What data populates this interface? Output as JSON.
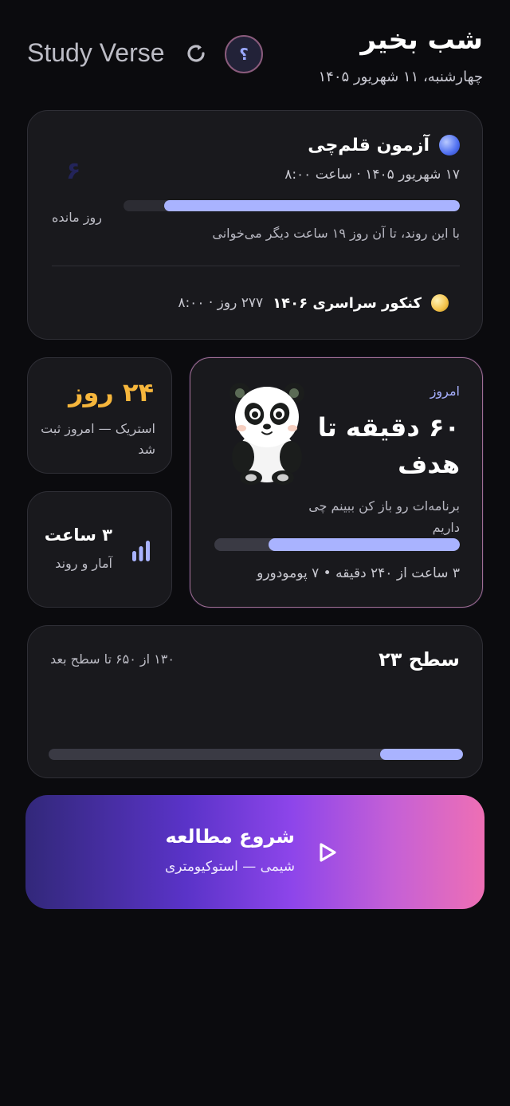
{
  "header": {
    "greeting": "شب بخیر",
    "date": "چهارشنبه، ۱۱ شهریور ۱۴۰۵",
    "brand": "Study Verse",
    "help_glyph": "؟"
  },
  "exam": {
    "title": "آزمون قلم‌چی",
    "date": "۱۷ شهریور ۱۴۰۵ · ساعت ۸:۰۰",
    "countdown_value": "۶",
    "countdown_label": "روز مانده",
    "progress_fraction": 0.88,
    "hint": "با این روند، تا آن روز ۱۹ ساعت دیگر می‌خوانی",
    "next_title": "کنکور سراسری ۱۴۰۶",
    "next_meta": "۲۷۷ روز · ۸:۰۰"
  },
  "streak": {
    "value": "۲۴ روز",
    "subtitle": "استریک — امروز ثبت شد"
  },
  "stats": {
    "value": "۳ ساعت",
    "subtitle": "آمار و روند",
    "icon": "bar-chart-icon"
  },
  "today": {
    "label": "امروز",
    "goal": "۶۰ دقیقه تا هدف",
    "message": "برنامه‌ات رو باز کن ببینم چی داریم",
    "progress_fraction": 0.78,
    "stats": "۳ ساعت از ۲۴۰ دقیقه • ۷ پومودورو",
    "mascot": "panda-mascot"
  },
  "level": {
    "title": "سطح ۲۳",
    "xp": "۱۳۰ از ۶۵۰ تا سطح بعد",
    "progress_fraction": 0.2
  },
  "start": {
    "title": "شروع مطالعه",
    "subtitle": "شیمی — استوکیومتری",
    "icon": "play-icon"
  },
  "colors": {
    "accent": "#a9b3ff",
    "streak": "#f6b63c",
    "background": "#0b0b0e",
    "card": "#19191d"
  }
}
